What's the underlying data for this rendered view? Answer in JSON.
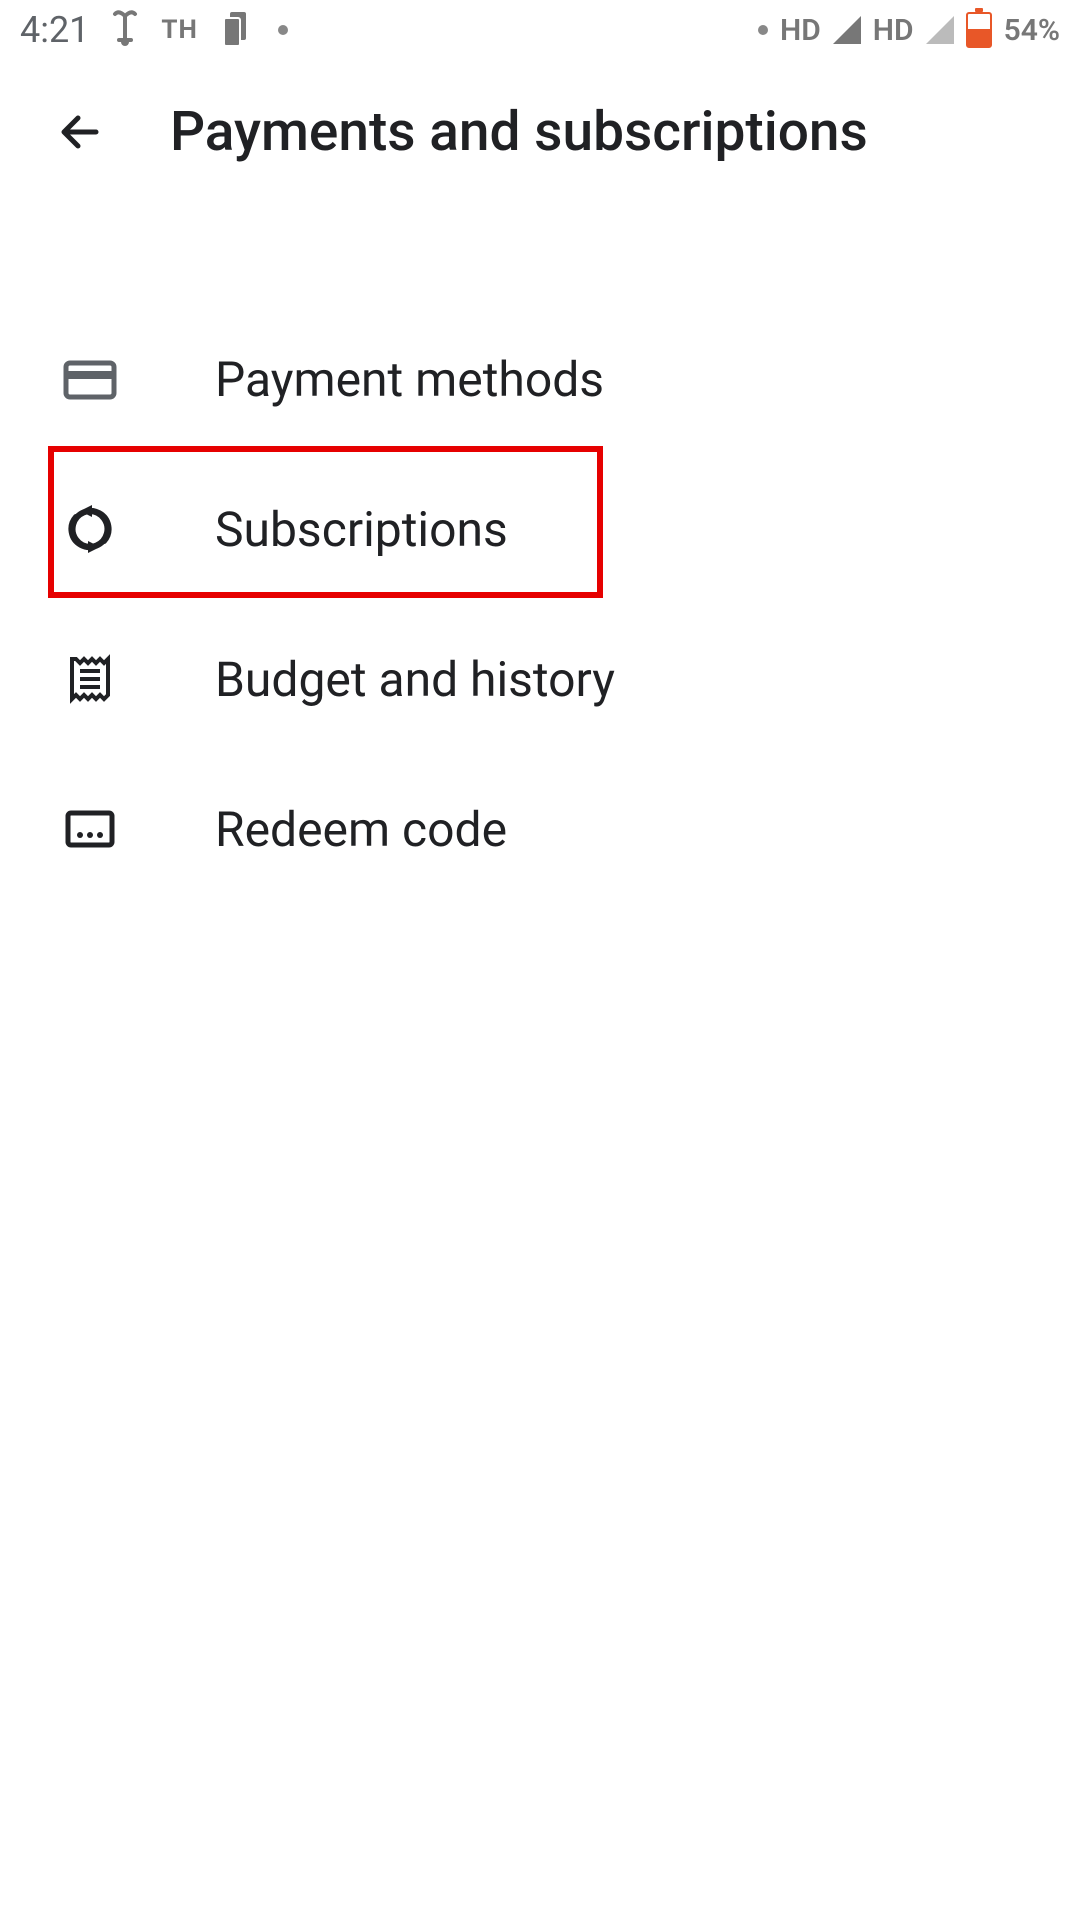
{
  "status_bar": {
    "time": "4:21",
    "th": "TH",
    "hd1": "HD",
    "hd2": "HD",
    "battery": "54%"
  },
  "header": {
    "title": "Payments and subscriptions"
  },
  "menu": {
    "items": [
      {
        "label": "Payment methods"
      },
      {
        "label": "Subscriptions"
      },
      {
        "label": "Budget and history"
      },
      {
        "label": "Redeem code"
      }
    ]
  }
}
